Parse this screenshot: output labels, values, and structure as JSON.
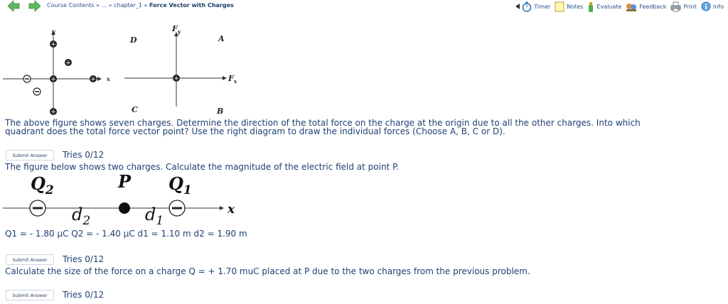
{
  "breadcrumb": {
    "course": "Course Contents",
    "sep1": "»",
    "ellipsis": "...",
    "sep2": "»",
    "chapter": "chapter_1",
    "sep3": "»",
    "current": "Force Vector with Charges"
  },
  "toolbar": {
    "timer": "Timer",
    "notes": "Notes",
    "evaluate": "Evaluate",
    "feedback": "Feedback",
    "print": "Print",
    "info": "Info"
  },
  "figure1": {
    "y_label": "y",
    "x_label": "x",
    "q_D": "D",
    "q_A": "A",
    "q_C": "C",
    "q_B": "B",
    "fy": "F",
    "fy_sub": "y",
    "fx": "F",
    "fx_sub": "x"
  },
  "problem1": {
    "line1": "The above figure shows seven charges. Determine the direction of the total force on the charge at the origin due to all the other charges. Into which",
    "line2": "quadrant does the total force vector point? Use the right diagram to draw the individual forces (Choose A, B, C or D).",
    "submit_label": "Submit Answer",
    "tries": "Tries 0/12"
  },
  "problem2": {
    "intro": "The figure below shows two charges. Calculate the magnitude of the electric field at point P.",
    "q2_letter": "Q",
    "q2_sub": "2",
    "p_label": "P",
    "q1_letter": "Q",
    "q1_sub": "1",
    "d2_letter": "d",
    "d2_sub": "2",
    "d1_letter": "d",
    "d1_sub": "1",
    "x_label": "x",
    "values": "Q1 = - 1.80 μC Q2 = - 1.40 μC d1 = 1.10 m d2 = 1.90 m",
    "submit_label": "Submit Answer",
    "tries": "Tries 0/12"
  },
  "problem3": {
    "text": "Calculate the size of the force on a charge Q = + 1.70 muC placed at P due to the two charges from the previous problem.",
    "submit_label": "Submit Answer",
    "tries": "Tries 0/12"
  },
  "colors": {
    "nav_arrow": "#5cb85c",
    "text": "#1f3f73"
  }
}
